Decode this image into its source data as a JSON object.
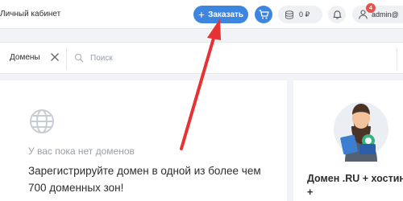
{
  "header": {
    "cabinet_title": "Личный кабинет",
    "order_button_label": "Заказать",
    "balance_amount": "0 ₽",
    "notification_count": "4",
    "username": "admin@"
  },
  "filter": {
    "chip_label": "Домены",
    "search_placeholder": "Поиск"
  },
  "empty_state": {
    "title": "У вас пока нет доменов",
    "text": "Зарегистрируйте домен в одной из более чем 700 доменных зон!"
  },
  "promo": {
    "title": "Домен .RU + хостинг",
    "continuation": "+"
  },
  "colors": {
    "accent": "#3d86e0",
    "annotation_arrow": "#e63232",
    "badge": "#e5534b"
  },
  "icons": [
    "plus-icon",
    "cart-icon",
    "wallet-icon",
    "bell-icon",
    "user-icon",
    "close-icon",
    "search-icon",
    "globe-icon"
  ]
}
